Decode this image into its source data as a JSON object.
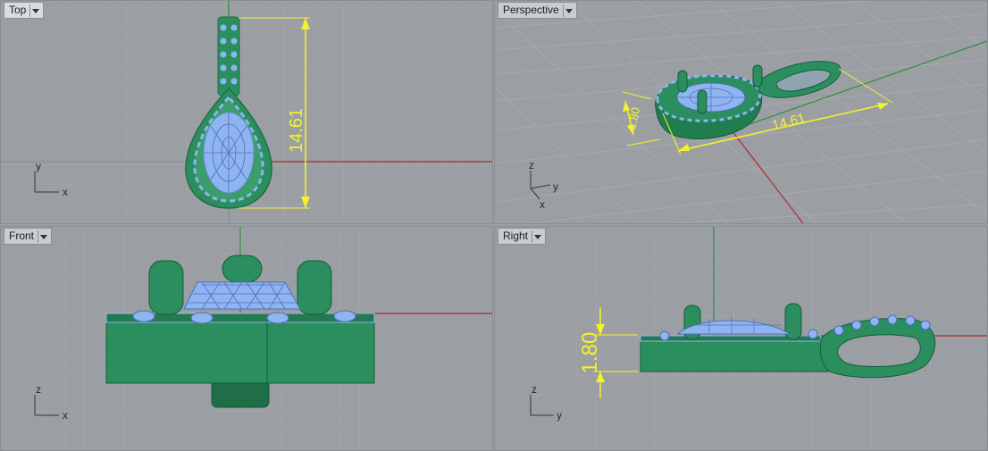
{
  "viewports": {
    "top": {
      "label": "Top",
      "dimension": "14.61",
      "axes": {
        "a": "y",
        "b": "x"
      }
    },
    "perspective": {
      "label": "Perspective",
      "dimension_length": "14.61",
      "dimension_height": "1.80",
      "axes": {
        "a": "z",
        "b": "y",
        "c": "x"
      }
    },
    "front": {
      "label": "Front",
      "axes": {
        "a": "z",
        "b": "x"
      }
    },
    "right": {
      "label": "Right",
      "dimension": "1.80",
      "axes": {
        "a": "z",
        "b": "y"
      }
    }
  },
  "colors": {
    "grid_bg": "#9b9fa3",
    "grid_minor": "#a7abaf",
    "grid_major": "#8c9094",
    "axis_x": "#b0282a",
    "axis_y": "#2f8f3a",
    "dimension": "#f4f32a",
    "metal": "#2b8e5e",
    "stone": "#8fb4f2"
  }
}
